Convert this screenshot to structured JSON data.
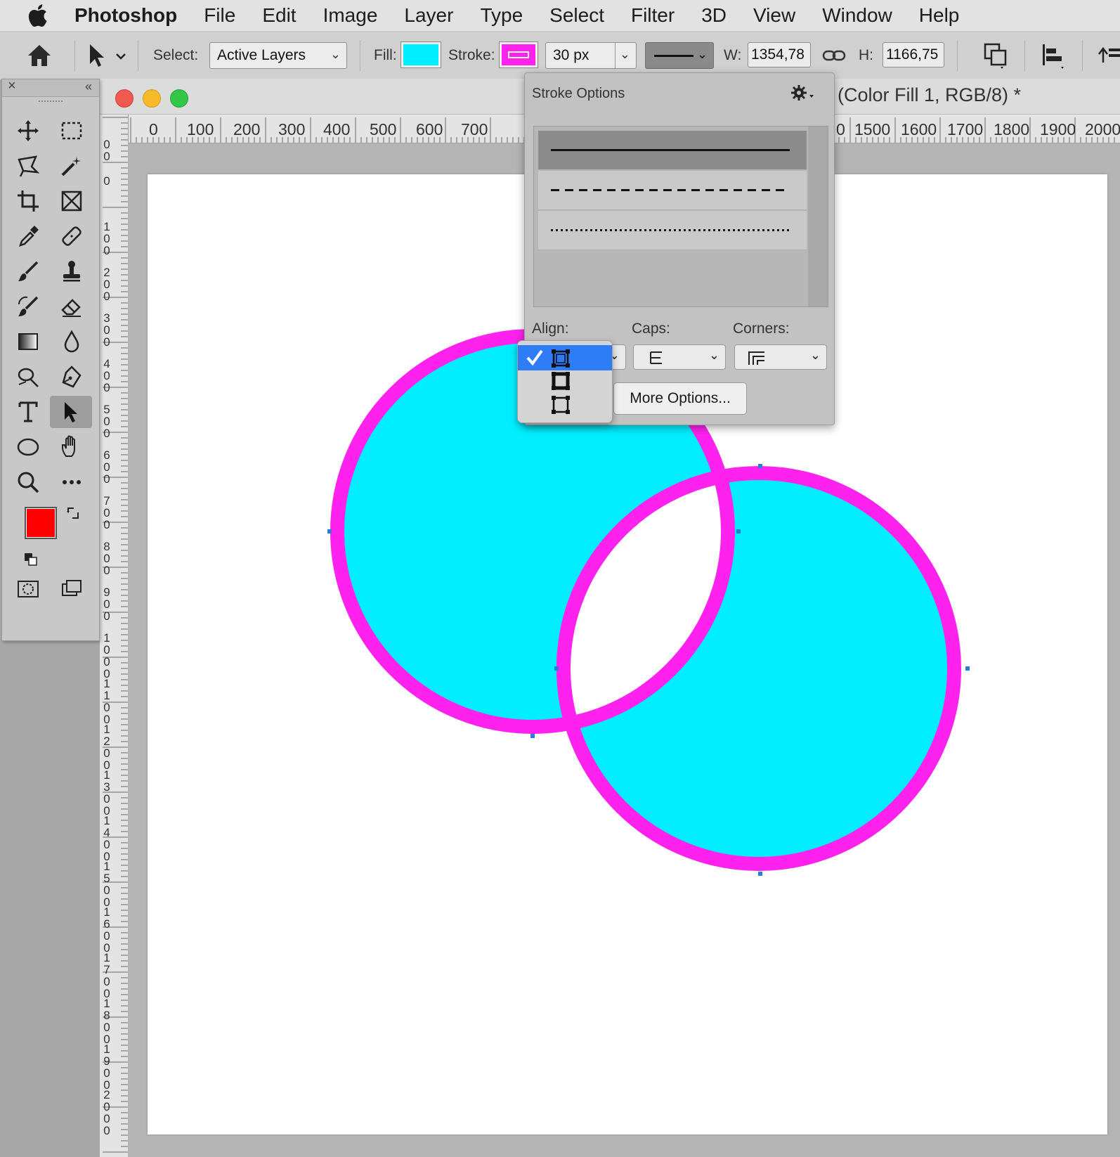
{
  "menubar": {
    "items": [
      "Photoshop",
      "File",
      "Edit",
      "Image",
      "Layer",
      "Type",
      "Select",
      "Filter",
      "3D",
      "View",
      "Window",
      "Help"
    ]
  },
  "optionsbar": {
    "select_label": "Select:",
    "select_value": "Active Layers",
    "fill_label": "Fill:",
    "fill_color": "#00eeff",
    "stroke_label": "Stroke:",
    "stroke_color": "#ff22ee",
    "stroke_width": "30 px",
    "w_label": "W:",
    "w_value": "1354,78",
    "h_label": "H:",
    "h_value": "1166,75"
  },
  "document": {
    "title": "(Color Fill 1, RGB/8) *",
    "ruler_top_labels": [
      "0",
      "100",
      "200",
      "300",
      "400",
      "500",
      "600",
      "700",
      "0",
      "1500",
      "1600",
      "1700",
      "1800",
      "1900",
      "2000"
    ],
    "ruler_left_labels": [
      "0\n0",
      "0",
      "1\n0\n0",
      "2\n0\n0",
      "3\n0\n0",
      "4\n0\n0",
      "5\n0\n0",
      "6\n0\n0",
      "7\n0\n0",
      "8\n0\n0",
      "9\n0\n0",
      "1\n0\n0\n0",
      "1\n1\n0\n0",
      "1\n2\n0\n0",
      "1\n3\n0\n0",
      "1\n4\n0\n0",
      "1\n5\n0\n0",
      "1\n6\n0\n0",
      "1\n7\n0\n0",
      "1\n8\n0\n0",
      "1\n9\n0\n0",
      "2\n0\n0\n0"
    ]
  },
  "stroke_panel": {
    "title": "Stroke Options",
    "styles": [
      "solid",
      "dashed",
      "dotted"
    ],
    "align_label": "Align:",
    "caps_label": "Caps:",
    "corners_label": "Corners:",
    "more_options": "More Options..."
  },
  "align_menu": {
    "options": [
      "inside",
      "center",
      "outside"
    ],
    "selected": "inside"
  },
  "colors": {
    "foreground": "#ff0000",
    "background": "#ffffff",
    "shape_fill": "#00eeff",
    "shape_stroke": "#ff22ee",
    "selection_accent": "#2f7df6"
  }
}
